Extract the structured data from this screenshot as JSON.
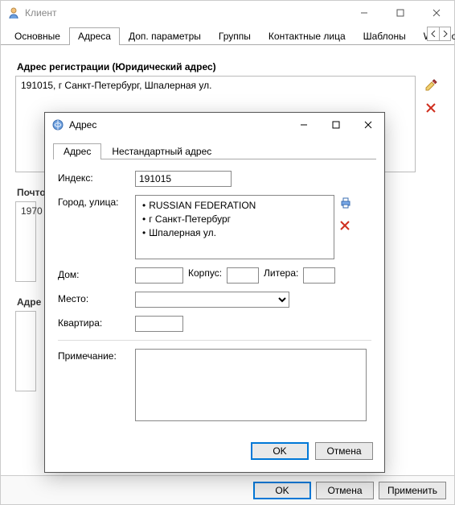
{
  "main": {
    "title": "Клиент",
    "tabs": [
      "Основные",
      "Адреса",
      "Доп. параметры",
      "Группы",
      "Контактные лица",
      "Шаблоны",
      "Web-пользовател"
    ],
    "active_tab": 1,
    "section1_title": "Адрес регистрации (Юридический адрес)",
    "section1_content": "191015, г Санкт-Петербург, Шпалерная ул.",
    "section2_title": "Почто",
    "section2_content_fragment": "1970",
    "section3_title": "Адре",
    "footer": {
      "ok": "OK",
      "cancel": "Отмена",
      "apply": "Применить"
    }
  },
  "dialog": {
    "title": "Адрес",
    "tabs": [
      "Адрес",
      "Нестандартный адрес"
    ],
    "active_tab": 0,
    "labels": {
      "index": "Индекс:",
      "city_street": "Город, улица:",
      "house": "Дом:",
      "building": "Корпус:",
      "litera": "Литера:",
      "place": "Место:",
      "flat": "Квартира:",
      "note": "Примечание:"
    },
    "values": {
      "index": "191015",
      "city_lines": [
        "RUSSIAN FEDERATION",
        "г Санкт-Петербург",
        "Шпалерная ул."
      ],
      "house": "",
      "building": "",
      "litera": "",
      "place": "",
      "flat": "",
      "note": ""
    },
    "footer": {
      "ok": "OK",
      "cancel": "Отмена"
    }
  }
}
